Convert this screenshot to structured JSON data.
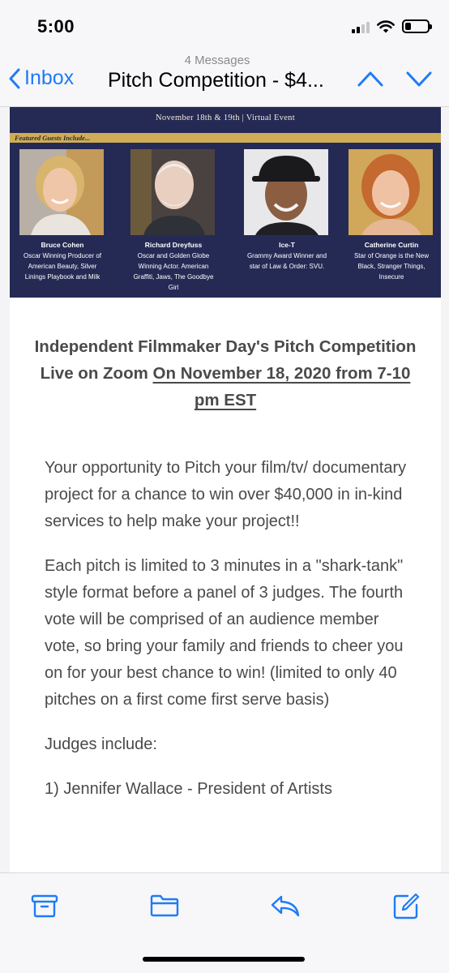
{
  "status": {
    "time": "5:00"
  },
  "nav": {
    "back_label": "Inbox",
    "message_count": "4 Messages",
    "title": "Pitch Competition - $4..."
  },
  "banner": {
    "date_line": "November 18th & 19th | Virtual Event",
    "featured_label": "Featured Guests Include...",
    "guests": [
      {
        "name": "Bruce Cohen",
        "desc": "Oscar Winning Producer of American Beauty, Silver Linings Playbook and Milk"
      },
      {
        "name": "Richard Dreyfuss",
        "desc": "Oscar and Golden Globe Winning Actor. American Graffiti, Jaws, The Goodbye Girl"
      },
      {
        "name": "Ice-T",
        "desc": "Grammy Award Winner and star of Law & Order: SVU."
      },
      {
        "name": "Catherine Curtin",
        "desc": "Star of Orange is the New Black, Stranger Things, Insecure"
      }
    ]
  },
  "content": {
    "heading_plain": "Independent Filmmaker Day's Pitch Competition Live on Zoom ",
    "heading_underlined": "On November 18, 2020 from 7-10 pm EST",
    "p1": "Your opportunity to Pitch your film/tv/ documentary project for a chance to win over $40,000 in in-kind services to help make your project!!",
    "p2": "Each pitch is limited to 3 minutes in a \"shark-tank\" style format before a panel of 3 judges. The fourth vote will be comprised of an audience member vote, so bring your family and friends to cheer you on for your best chance to win! (limited to only 40 pitches on a first come first serve basis)",
    "p3": "Judges include:",
    "p4": "1) Jennifer Wallace - President of Artists"
  },
  "colors": {
    "accent": "#1f7bf6",
    "banner": "#252a55",
    "gold": "#cfac58"
  },
  "icons": [
    "chevron-left-icon",
    "chevron-up-icon",
    "chevron-down-icon",
    "archive-icon",
    "folder-icon",
    "reply-icon",
    "compose-icon",
    "signal-icon",
    "wifi-icon",
    "battery-icon"
  ]
}
